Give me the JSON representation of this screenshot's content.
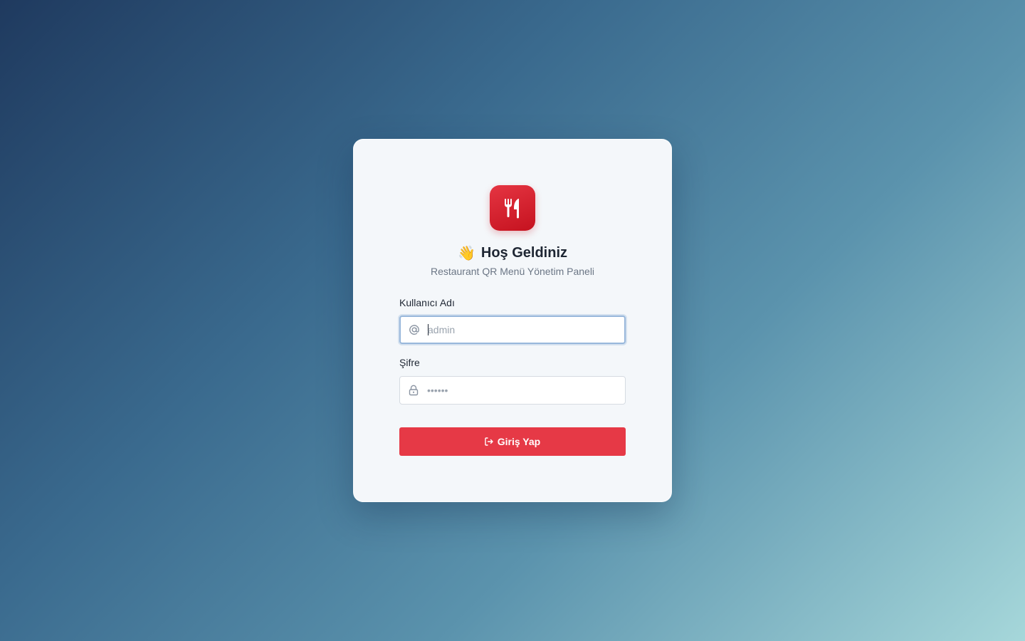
{
  "header": {
    "wave_emoji": "👋",
    "title": "Hoş Geldiniz",
    "subtitle": "Restaurant QR Menü Yönetim Paneli"
  },
  "form": {
    "username": {
      "label": "Kullanıcı Adı",
      "placeholder": "admin",
      "value": "",
      "icon": "at-sign-icon"
    },
    "password": {
      "label": "Şifre",
      "placeholder": "••••••",
      "value": "",
      "icon": "lock-icon"
    },
    "submit_label": "Giriş Yap",
    "submit_icon": "sign-in-icon"
  },
  "colors": {
    "brand_red": "#e63946",
    "logo_red": "#d41f2c",
    "card_bg": "#f4f7fa",
    "focus_ring": "#98b7db"
  },
  "logo": {
    "icon": "utensils-icon"
  }
}
